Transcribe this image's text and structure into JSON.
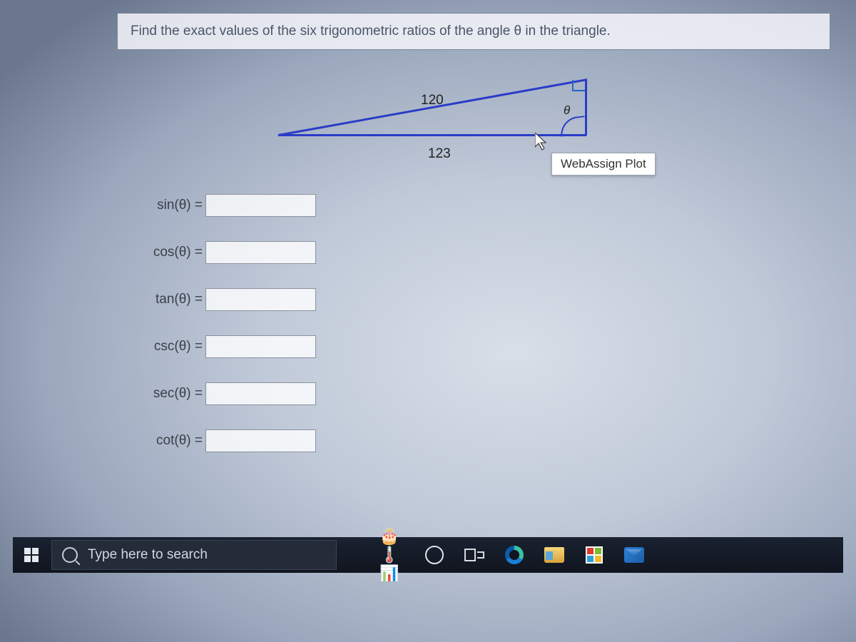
{
  "question": {
    "prompt": "Find the exact values of the six trigonometric ratios of the angle θ in the triangle."
  },
  "figure": {
    "hypotenuse_label": "120",
    "base_label": "123",
    "angle_label": "θ",
    "tooltip": "WebAssign Plot"
  },
  "answers": [
    {
      "label": "sin(θ) =",
      "value": ""
    },
    {
      "label": "cos(θ) =",
      "value": ""
    },
    {
      "label": "tan(θ) =",
      "value": ""
    },
    {
      "label": "csc(θ) =",
      "value": ""
    },
    {
      "label": "sec(θ) =",
      "value": ""
    },
    {
      "label": "cot(θ) =",
      "value": ""
    }
  ],
  "taskbar": {
    "search_placeholder": "Type here to search"
  }
}
